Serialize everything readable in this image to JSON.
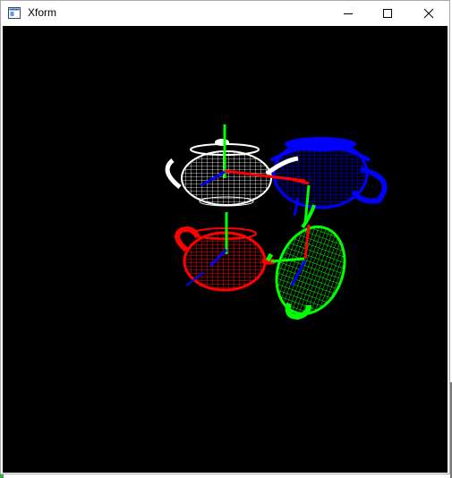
{
  "window": {
    "title": "Xform"
  },
  "controls": {
    "minimize": "minimize-icon",
    "maximize": "maximize-icon",
    "close": "close-icon"
  },
  "scene": {
    "teapots": [
      {
        "color": "#ffffff",
        "name": "white"
      },
      {
        "color": "#0000ff",
        "name": "blue"
      },
      {
        "color": "#ff0000",
        "name": "red"
      },
      {
        "color": "#00ff00",
        "name": "green"
      }
    ],
    "axis_colors": {
      "x": "#ff0000",
      "y": "#00ff00",
      "z": "#0000ff"
    }
  }
}
